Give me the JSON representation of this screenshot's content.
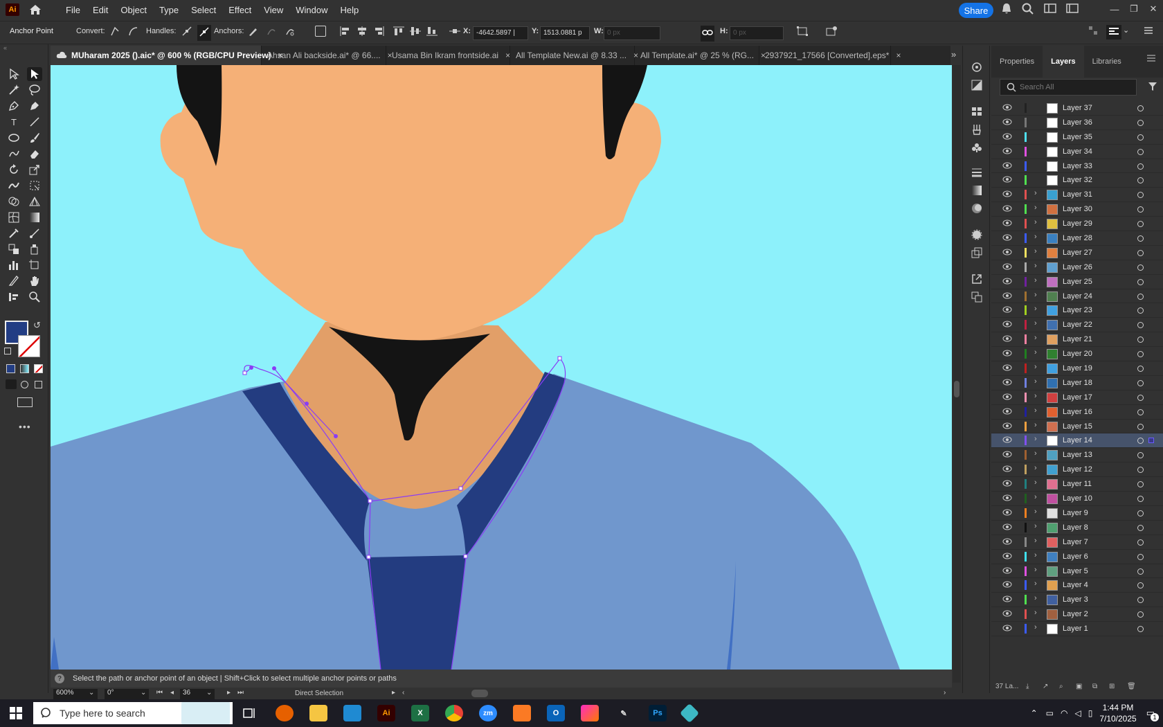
{
  "app": {
    "logo": "Ai",
    "menu": [
      "File",
      "Edit",
      "Object",
      "Type",
      "Select",
      "Effect",
      "View",
      "Window",
      "Help"
    ],
    "share_label": "Share"
  },
  "control_bar": {
    "tool_name": "Anchor Point",
    "convert_label": "Convert:",
    "handles_label": "Handles:",
    "anchors_label": "Anchors:",
    "x_label": "X:",
    "x_value": "-4642.5897 |",
    "y_label": "Y:",
    "y_value": "1513.0881 p",
    "w_label": "W:",
    "w_value": "0 px",
    "h_label": "H:",
    "h_value": "0 px"
  },
  "tabs": [
    {
      "label": "MUharam 2025 ().aic* @ 600 % (RGB/CPU Preview)",
      "close": "×",
      "active": true
    },
    {
      "label": "Ahsan Ali backside.ai* @ 66....",
      "close": "×",
      "active": false
    },
    {
      "label": "Usama Bin Ikram frontside.ai",
      "close": "×",
      "active": false
    },
    {
      "label": "All Template New.ai @ 8.33 ...",
      "close": "×",
      "active": false
    },
    {
      "label": "All Template.ai* @ 25 % (RG...",
      "close": "×",
      "active": false
    },
    {
      "label": "2937921_17566 [Converted].eps*",
      "close": "×",
      "active": false
    }
  ],
  "status": {
    "help_icon": "?",
    "hint": "Select the path or anchor point of an object  |  Shift+Click to select multiple anchor points or paths",
    "zoom": "600%",
    "rotation": "0°",
    "artboard": "36",
    "tool": "Direct Selection"
  },
  "panel": {
    "tabs": [
      "Properties",
      "Layers",
      "Libraries"
    ],
    "active_tab": "Layers",
    "search_placeholder": "Search All",
    "footer": "37 La..."
  },
  "layers": [
    {
      "name": "Layer 37",
      "color": "#222222",
      "expand": false,
      "thumb": "#ffffff",
      "selected": false
    },
    {
      "name": "Layer 36",
      "color": "#777777",
      "expand": false,
      "thumb": "#ffffff",
      "selected": false
    },
    {
      "name": "Layer 35",
      "color": "#4fe0f0",
      "expand": false,
      "thumb": "#ffffff",
      "selected": false
    },
    {
      "name": "Layer 34",
      "color": "#e050e0",
      "expand": false,
      "thumb": "#ffffff",
      "selected": false
    },
    {
      "name": "Layer 33",
      "color": "#3b5cff",
      "expand": false,
      "thumb": "#ffffff",
      "selected": false
    },
    {
      "name": "Layer 32",
      "color": "#50e050",
      "expand": false,
      "thumb": "#ffffff",
      "selected": false
    },
    {
      "name": "Layer 31",
      "color": "#e05050",
      "expand": true,
      "thumb": "#3aa0d0",
      "selected": false
    },
    {
      "name": "Layer 30",
      "color": "#50e050",
      "expand": true,
      "thumb": "#d07040",
      "selected": false
    },
    {
      "name": "Layer 29",
      "color": "#e05050",
      "expand": true,
      "thumb": "#e0c040",
      "selected": false
    },
    {
      "name": "Layer 28",
      "color": "#3b5cff",
      "expand": true,
      "thumb": "#3a80c0",
      "selected": false
    },
    {
      "name": "Layer 27",
      "color": "#f0e060",
      "expand": true,
      "thumb": "#e08040",
      "selected": false
    },
    {
      "name": "Layer 26",
      "color": "#aaaaaa",
      "expand": true,
      "thumb": "#60a0d0",
      "selected": false
    },
    {
      "name": "Layer 25",
      "color": "#7020a0",
      "expand": true,
      "thumb": "#c070c0",
      "selected": false
    },
    {
      "name": "Layer 24",
      "color": "#a07030",
      "expand": true,
      "thumb": "#508050",
      "selected": false
    },
    {
      "name": "Layer 23",
      "color": "#a0d020",
      "expand": true,
      "thumb": "#40a0e0",
      "selected": false
    },
    {
      "name": "Layer 22",
      "color": "#c02040",
      "expand": true,
      "thumb": "#4070b0",
      "selected": false
    },
    {
      "name": "Layer 21",
      "color": "#f080a0",
      "expand": true,
      "thumb": "#e0a060",
      "selected": false
    },
    {
      "name": "Layer 20",
      "color": "#208020",
      "expand": true,
      "thumb": "#308030",
      "selected": false
    },
    {
      "name": "Layer 19",
      "color": "#c02020",
      "expand": true,
      "thumb": "#40a0e0",
      "selected": false
    },
    {
      "name": "Layer 18",
      "color": "#7080e0",
      "expand": true,
      "thumb": "#3070b0",
      "selected": false
    },
    {
      "name": "Layer 17",
      "color": "#f090b0",
      "expand": true,
      "thumb": "#d04040",
      "selected": false
    },
    {
      "name": "Layer 16",
      "color": "#2020a0",
      "expand": true,
      "thumb": "#e06030",
      "selected": false
    },
    {
      "name": "Layer 15",
      "color": "#f0a040",
      "expand": true,
      "thumb": "#d07050",
      "selected": false
    },
    {
      "name": "Layer 14",
      "color": "#8050f0",
      "expand": true,
      "thumb": "#ffffff",
      "selected": true
    },
    {
      "name": "Layer 13",
      "color": "#a06030",
      "expand": true,
      "thumb": "#50a0c0",
      "selected": false
    },
    {
      "name": "Layer 12",
      "color": "#c0a060",
      "expand": true,
      "thumb": "#40a0d0",
      "selected": false
    },
    {
      "name": "Layer 11",
      "color": "#208080",
      "expand": true,
      "thumb": "#e07090",
      "selected": false
    },
    {
      "name": "Layer 10",
      "color": "#206020",
      "expand": true,
      "thumb": "#c050a0",
      "selected": false
    },
    {
      "name": "Layer 9",
      "color": "#f08020",
      "expand": true,
      "thumb": "#e0e0e0",
      "selected": false
    },
    {
      "name": "Layer 8",
      "color": "#111111",
      "expand": true,
      "thumb": "#50a070",
      "selected": false
    },
    {
      "name": "Layer 7",
      "color": "#888888",
      "expand": true,
      "thumb": "#e06060",
      "selected": false
    },
    {
      "name": "Layer 6",
      "color": "#40e0f0",
      "expand": true,
      "thumb": "#4080c0",
      "selected": false
    },
    {
      "name": "Layer 5",
      "color": "#e050e0",
      "expand": true,
      "thumb": "#60a080",
      "selected": false
    },
    {
      "name": "Layer 4",
      "color": "#3b5cff",
      "expand": true,
      "thumb": "#e0a050",
      "selected": false
    },
    {
      "name": "Layer 3",
      "color": "#50e050",
      "expand": true,
      "thumb": "#4060a0",
      "selected": false
    },
    {
      "name": "Layer 2",
      "color": "#e05050",
      "expand": true,
      "thumb": "#a06040",
      "selected": false
    },
    {
      "name": "Layer 1",
      "color": "#3b5cff",
      "expand": true,
      "thumb": "#ffffff",
      "selected": false
    }
  ],
  "taskbar": {
    "search_placeholder": "Type here to search",
    "time": "1:44 PM",
    "date": "7/10/2025",
    "notif": "1"
  },
  "colors": {
    "fill": "#223d84",
    "canvas_bg": "#8df1fb",
    "skin": "#f5b077",
    "neck": "#e29f68",
    "shirt": "#7097cd",
    "collar": "#233c80",
    "hair": "#141414",
    "accent": "#1473e6"
  }
}
